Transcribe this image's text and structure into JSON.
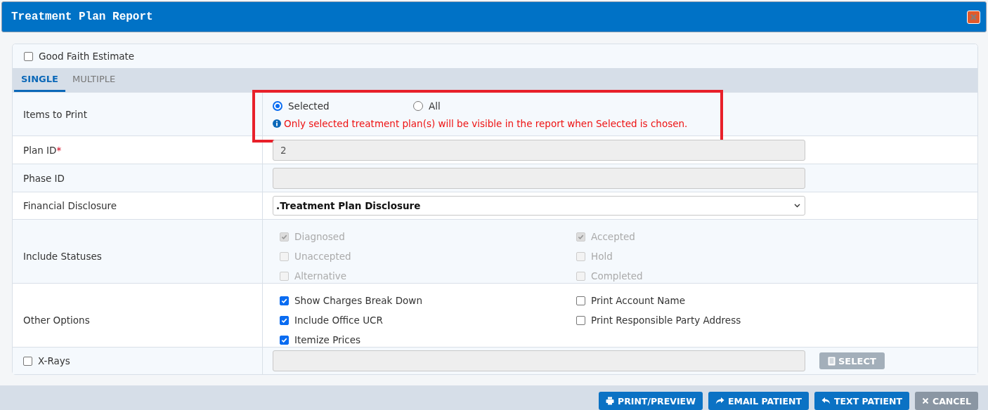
{
  "window": {
    "title": "Treatment Plan Report"
  },
  "good_faith_estimate": {
    "label": "Good Faith Estimate",
    "checked": false
  },
  "tabs": [
    {
      "label": "SINGLE",
      "selected": true
    },
    {
      "label": "MULTIPLE",
      "selected": false
    }
  ],
  "rows": [
    {
      "kind": "radio",
      "label": "Items to Print",
      "options": [
        {
          "label": "Selected",
          "selected": true
        },
        {
          "label": "All",
          "selected": false
        }
      ],
      "note": "Only selected treatment plan(s) will be visible in the report when Selected is chosen."
    },
    {
      "kind": "input",
      "label": "Plan ID",
      "required_mark": "*",
      "value": "2",
      "disabled": true
    },
    {
      "kind": "input",
      "label": "Phase ID",
      "disabled": true
    },
    {
      "kind": "select",
      "label": "Financial Disclosure",
      "value": ".Treatment Plan Disclosure"
    },
    {
      "kind": "checks",
      "label": "Include Statuses",
      "disabled": true,
      "columns": [
        [
          {
            "label": "Diagnosed",
            "checked": true
          },
          {
            "label": "Unaccepted",
            "checked": false
          },
          {
            "label": "Alternative",
            "checked": false
          }
        ],
        [
          {
            "label": "Accepted",
            "checked": true
          },
          {
            "label": "Hold",
            "checked": false
          },
          {
            "label": "Completed",
            "checked": false
          }
        ]
      ]
    },
    {
      "kind": "checks",
      "label": "Other Options",
      "disabled": false,
      "columns": [
        [
          {
            "label": "Show Charges Break Down",
            "checked": true
          },
          {
            "label": "Include Office UCR",
            "checked": true
          },
          {
            "label": "Itemize Prices",
            "checked": true
          }
        ],
        [
          {
            "label": "Print Account Name",
            "checked": false
          },
          {
            "label": "Print Responsible Party Address",
            "checked": false
          }
        ]
      ]
    },
    {
      "kind": "xrays",
      "label": "X-Rays",
      "checked": false,
      "button": "SELECT",
      "button_disabled": true
    }
  ],
  "buttons": [
    {
      "label": "PRINT/PREVIEW",
      "kind": "primary"
    },
    {
      "label": "EMAIL PATIENT",
      "kind": "primary"
    },
    {
      "label": "TEXT PATIENT",
      "kind": "primary"
    },
    {
      "label": "CANCEL",
      "kind": "secondary"
    }
  ]
}
